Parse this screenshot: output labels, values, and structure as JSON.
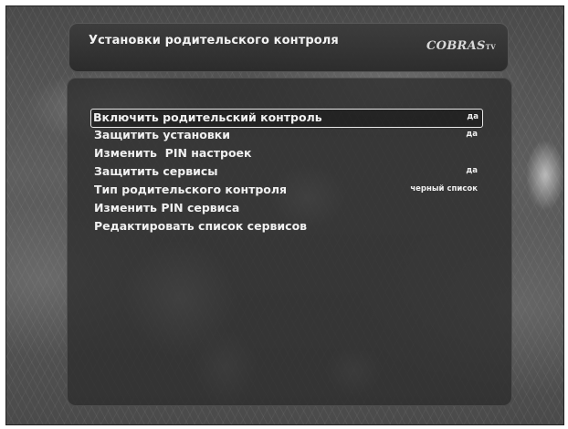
{
  "header": {
    "title": "Установки родительского контроля",
    "logo": "COBRAS",
    "logo_suffix": "TV"
  },
  "menu": {
    "selected_index": 0,
    "items": [
      {
        "label": "Включить родительский контроль",
        "value": "да"
      },
      {
        "label": "Защитить установки",
        "value": "да"
      },
      {
        "label": "Изменить  PIN настроек",
        "value": ""
      },
      {
        "label": "Защитить сервисы",
        "value": "да"
      },
      {
        "label": "Тип родительского контроля",
        "value": "черный список"
      },
      {
        "label": "Изменить PIN сервиса",
        "value": ""
      },
      {
        "label": "Редактировать список сервисов",
        "value": ""
      }
    ]
  }
}
